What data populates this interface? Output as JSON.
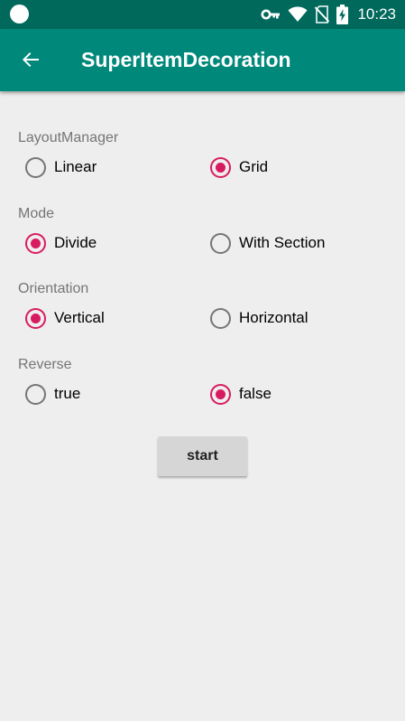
{
  "status_bar": {
    "time": "10:23",
    "icons": [
      "circle-icon",
      "key-icon",
      "wifi-icon",
      "no-sim-icon",
      "battery-charging-icon"
    ]
  },
  "app_bar": {
    "title": "SuperItemDecoration",
    "back_icon": "arrow-left-icon"
  },
  "groups": {
    "layout_manager": {
      "label": "LayoutManager",
      "options": [
        {
          "label": "Linear",
          "checked": false
        },
        {
          "label": "Grid",
          "checked": true
        }
      ]
    },
    "mode": {
      "label": "Mode",
      "options": [
        {
          "label": "Divide",
          "checked": true
        },
        {
          "label": "With Section",
          "checked": false
        }
      ]
    },
    "orientation": {
      "label": "Orientation",
      "options": [
        {
          "label": "Vertical",
          "checked": true
        },
        {
          "label": "Horizontal",
          "checked": false
        }
      ]
    },
    "reverse": {
      "label": "Reverse",
      "options": [
        {
          "label": "true",
          "checked": false
        },
        {
          "label": "false",
          "checked": true
        }
      ]
    }
  },
  "start_button": {
    "label": "start"
  },
  "colors": {
    "status_bar": "#00695c",
    "app_bar": "#00897b",
    "accent": "#d81b60",
    "background": "#eeeeee"
  }
}
